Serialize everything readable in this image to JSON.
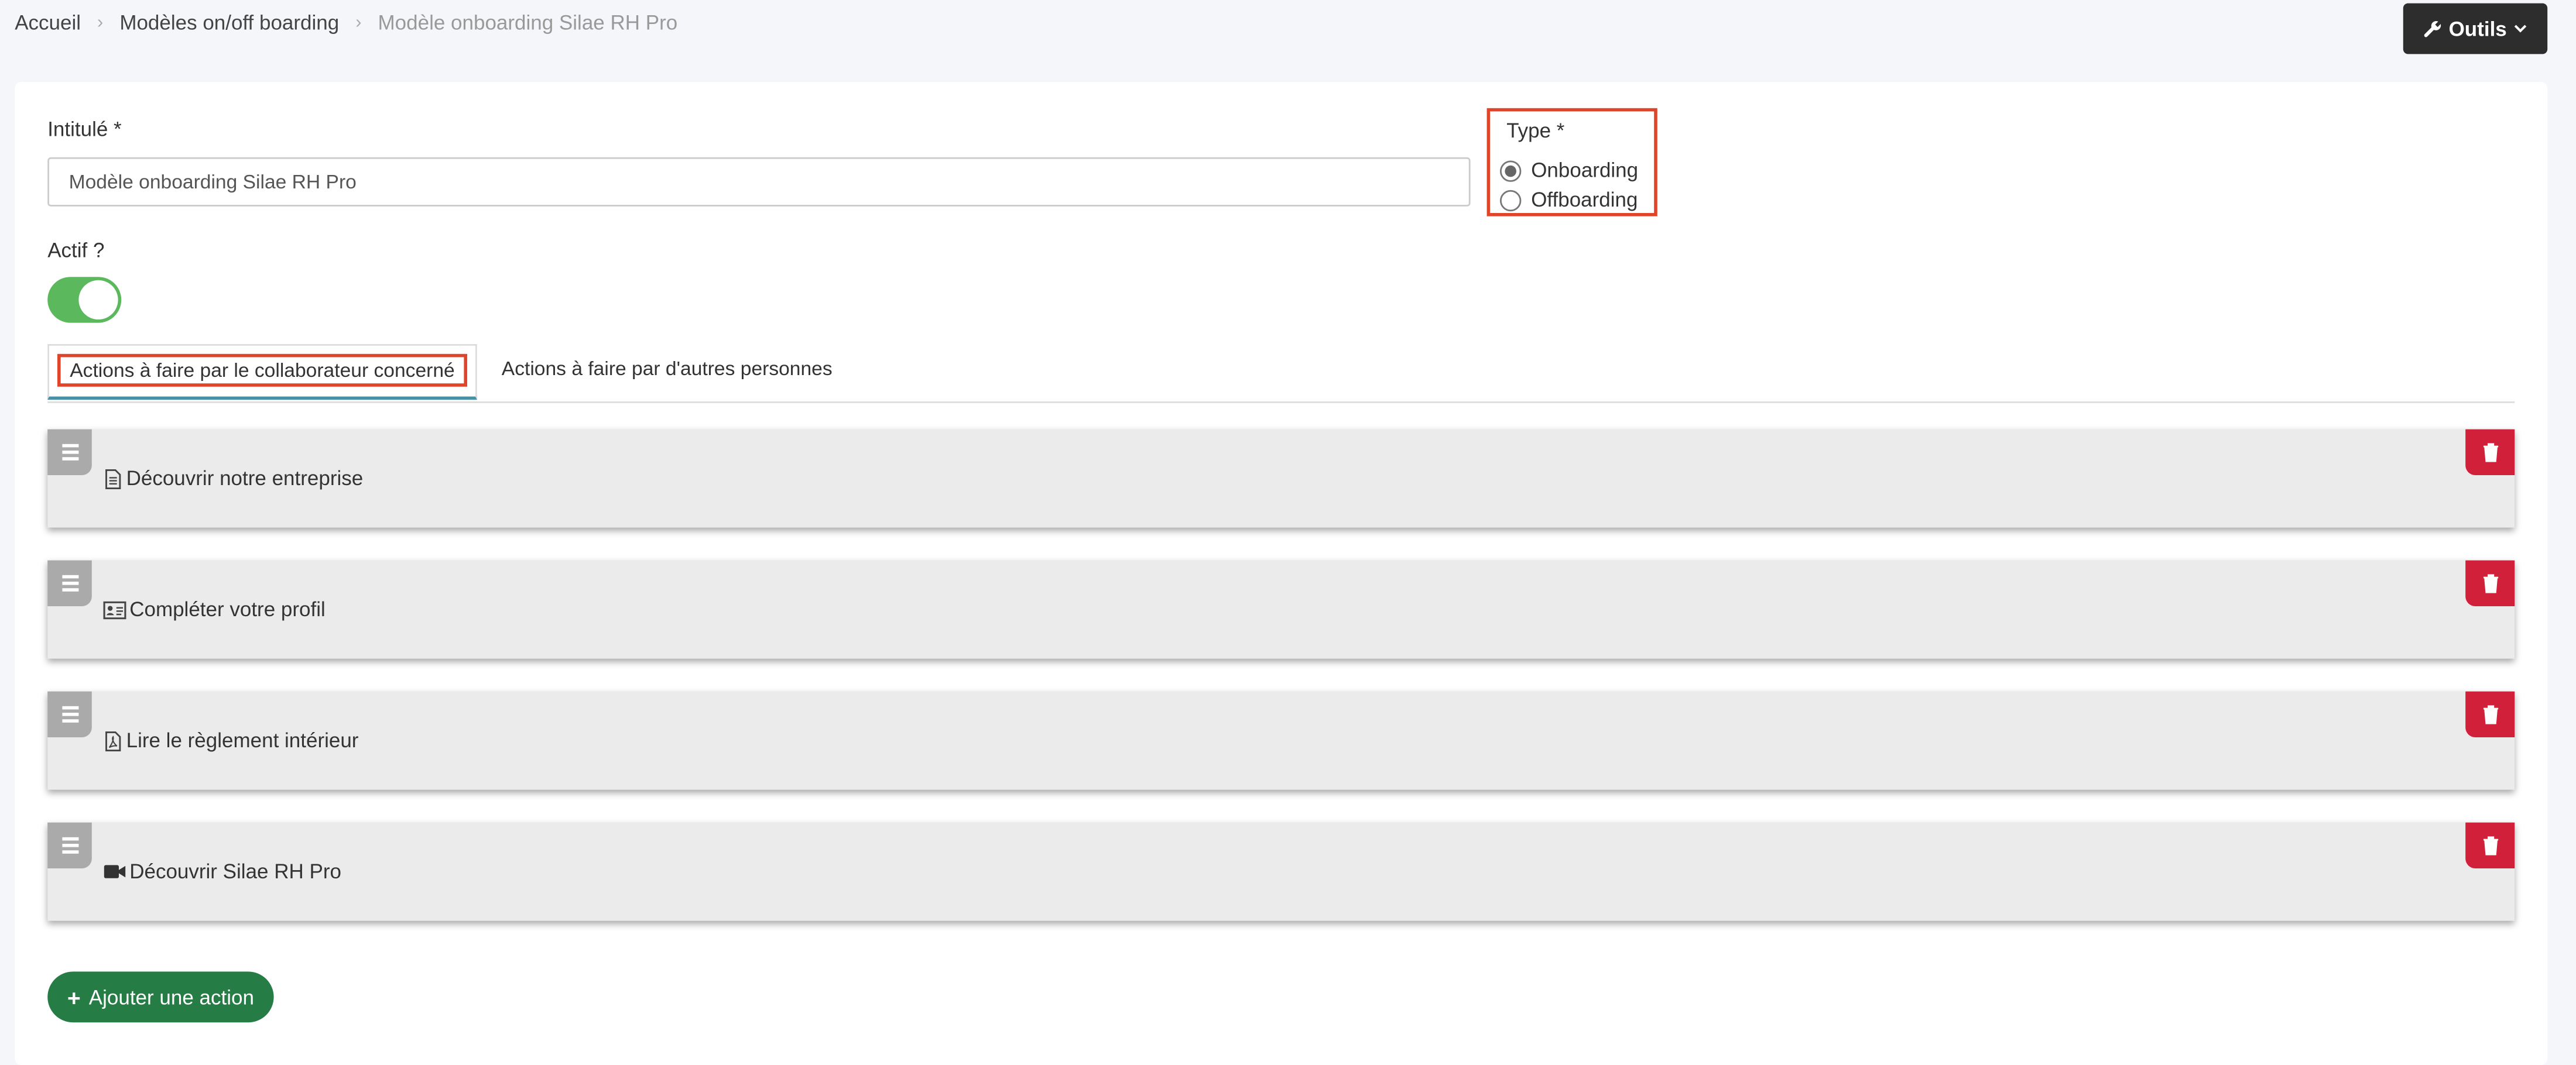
{
  "breadcrumb": {
    "home": "Accueil",
    "models": "Modèles on/off boarding",
    "current": "Modèle onboarding Silae RH Pro"
  },
  "toolbar": {
    "tools_label": "Outils"
  },
  "form": {
    "title_label": "Intitulé *",
    "title_value": "Modèle onboarding Silae RH Pro",
    "type_label": "Type *",
    "type_options": [
      "Onboarding",
      "Offboarding"
    ],
    "type_selected": "Onboarding",
    "active_label": "Actif ?",
    "active": true
  },
  "tabs": [
    {
      "label": "Actions à faire par le collaborateur concerné",
      "active": true
    },
    {
      "label": "Actions à faire par d'autres personnes",
      "active": false
    }
  ],
  "actions": [
    {
      "label": "Découvrir notre entreprise",
      "icon": "document-icon"
    },
    {
      "label": "Compléter votre profil",
      "icon": "id-card-icon"
    },
    {
      "label": "Lire le règlement intérieur",
      "icon": "pdf-file-icon"
    },
    {
      "label": "Découvrir Silae RH Pro",
      "icon": "video-icon"
    }
  ],
  "add_action_label": "Ajouter une action",
  "colors": {
    "accent_green": "#267c45",
    "toggle_green": "#5cb85c",
    "delete_red": "#d0203a",
    "highlight": "#e0452a",
    "tools_dark": "#2d2d2d"
  }
}
